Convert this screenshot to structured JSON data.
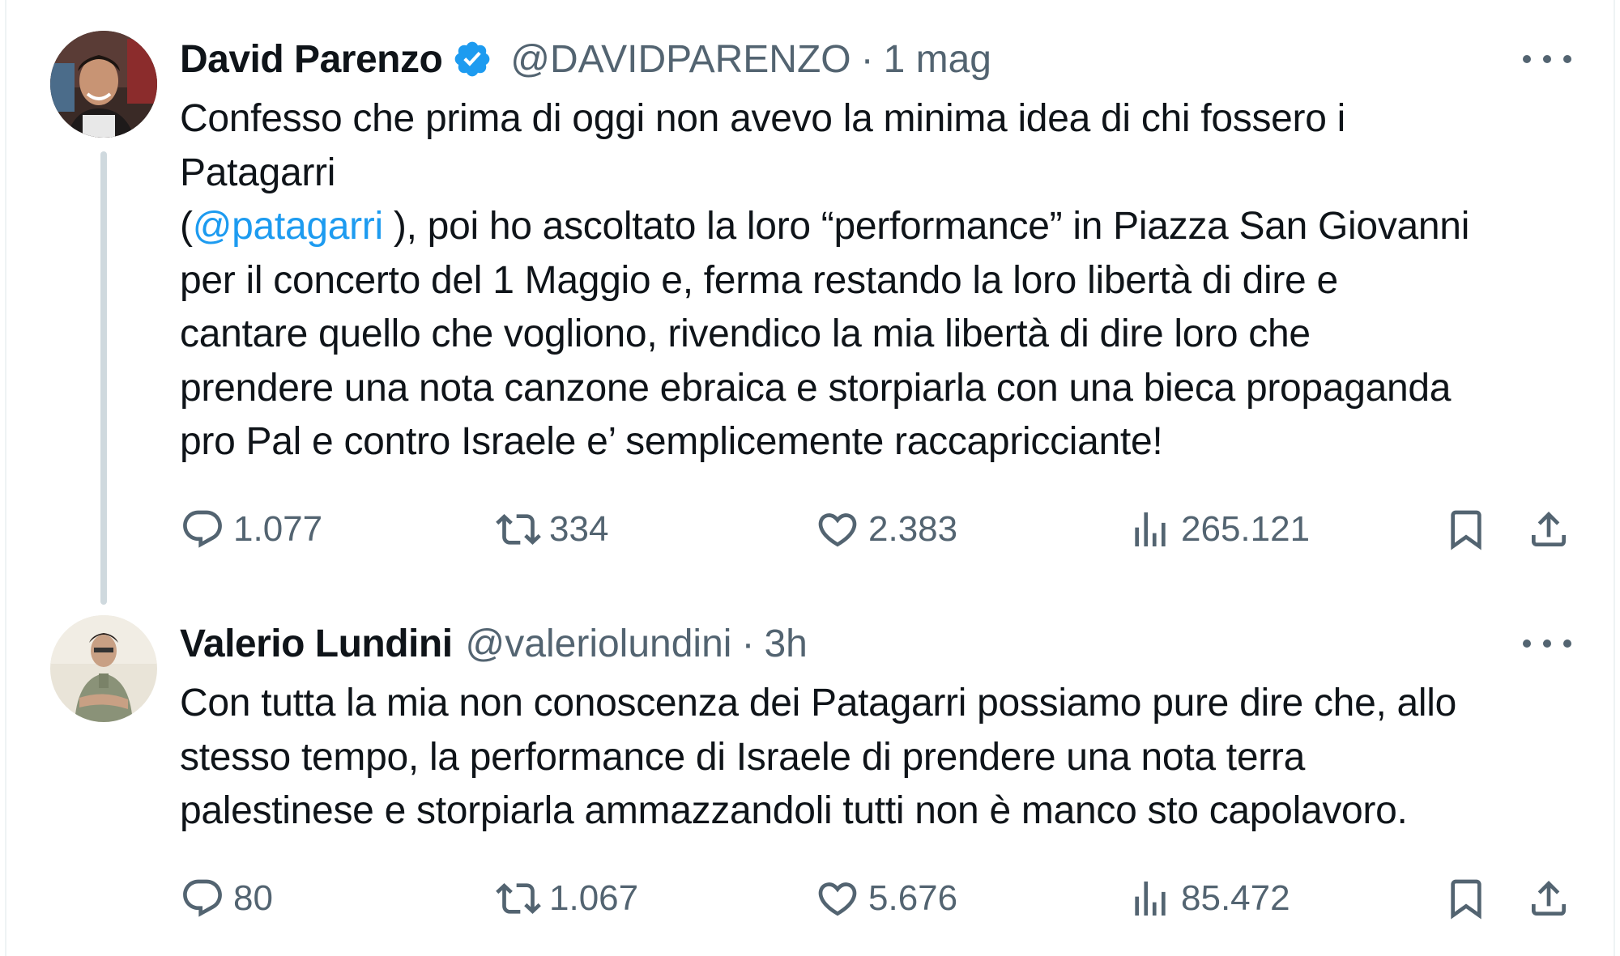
{
  "tweets": [
    {
      "author_name": "David Parenzo",
      "verified": true,
      "handle": "@DAVIDPARENZO",
      "separator": "·",
      "time": "1 mag",
      "text_lines": [
        "Confesso che prima di oggi non avevo la minima idea di chi fossero i",
        "Patagarri"
      ],
      "mention_open": "(",
      "mention": "@patagarri",
      "mention_after": " ), poi ho ascoltato la loro “performance” in Piazza San Giovanni",
      "text_lines_after": [
        "per il concerto del 1 Maggio e, ferma restando la loro libertà di dire e",
        "cantare quello che vogliono, rivendico la mia libertà di dire loro che",
        "prendere una nota canzone ebraica e storpiarla con una bieca propaganda",
        "pro Pal e contro Israele e’ semplicemente raccapricciante!"
      ],
      "replies": "1.077",
      "retweets": "334",
      "likes": "2.383",
      "views": "265.121"
    },
    {
      "author_name": "Valerio Lundini",
      "verified": false,
      "handle": "@valeriolundini",
      "separator": "·",
      "time": "3h",
      "text_lines": [
        "Con tutta la mia non conoscenza dei Patagarri possiamo pure dire che, allo",
        "stesso tempo, la performance di Israele di prendere una nota terra",
        "palestinese e storpiarla ammazzandoli tutti non è manco sto capolavoro."
      ],
      "replies": "80",
      "retweets": "1.067",
      "likes": "5.676",
      "views": "85.472"
    }
  ],
  "icons": {
    "reply": "reply-icon",
    "retweet": "retweet-icon",
    "like": "heart-icon",
    "views": "analytics-icon",
    "bookmark": "bookmark-icon",
    "share": "share-icon",
    "more": "more-dots-icon",
    "verified": "verified-badge-icon"
  },
  "colors": {
    "text": "#0f1419",
    "secondary": "#536471",
    "link": "#1d9bf0",
    "verified": "#1d9bf0",
    "thread_line": "#cfd9de"
  }
}
